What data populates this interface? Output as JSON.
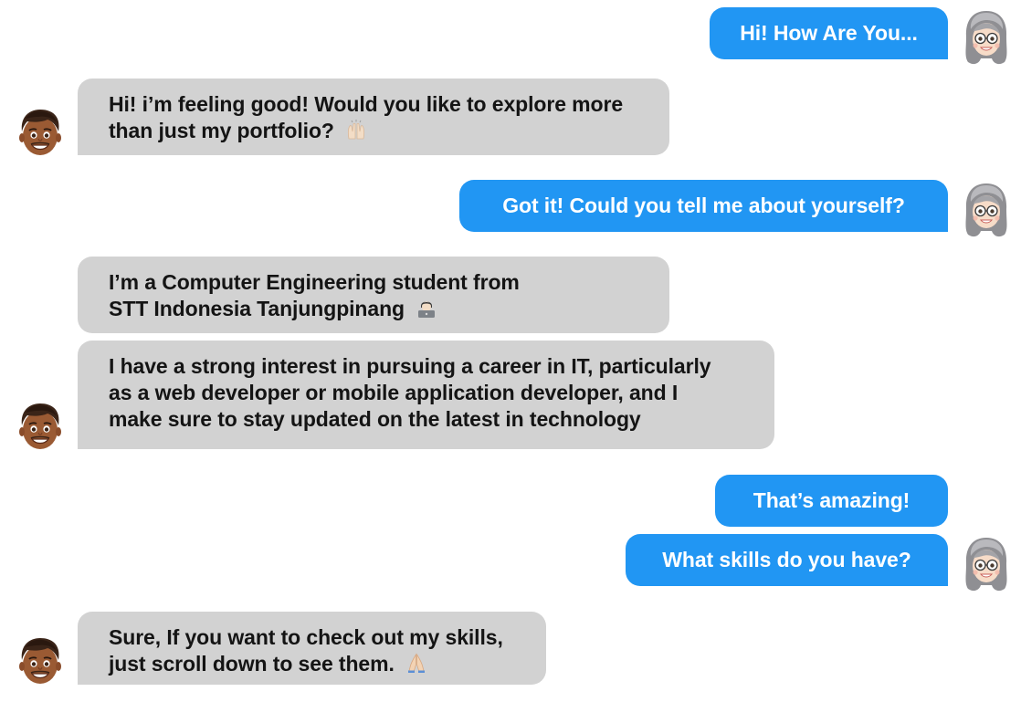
{
  "chat": {
    "messages": [
      {
        "sender": "user",
        "lines": [
          "Hi! How Are You..."
        ]
      },
      {
        "sender": "bot",
        "lines": [
          "Hi! i’m feeling good! Would you like to explore more",
          "than just my portfolio?"
        ],
        "emoji": "raising-hands-emoji"
      },
      {
        "sender": "user",
        "lines": [
          "Got it! Could you tell me about yourself?"
        ]
      },
      {
        "sender": "bot",
        "lines": [
          "I’m a Computer Engineering student from",
          "STT Indonesia Tanjungpinang"
        ],
        "emoji": "technologist-emoji"
      },
      {
        "sender": "bot",
        "lines": [
          "I have a strong interest in pursuing a career in IT, particularly",
          "as a web developer or mobile application developer, and I",
          "make sure to stay updated on the latest in technology"
        ]
      },
      {
        "sender": "user",
        "lines": [
          "That’s amazing!"
        ]
      },
      {
        "sender": "user",
        "lines": [
          "What skills do you have?"
        ]
      },
      {
        "sender": "bot",
        "lines": [
          "Sure, If you want to check out my skills,",
          "just scroll down to see them."
        ],
        "emoji": "folded-hands-emoji"
      }
    ]
  },
  "avatars": {
    "user": "memoji-grey-haired-woman-with-glasses-avatar",
    "bot": "memoji-man-brown-skin-avatar"
  },
  "colors": {
    "outgoing_bubble": "#2196f3",
    "outgoing_text": "#ffffff",
    "incoming_bubble": "#d2d2d2",
    "incoming_text": "#141414"
  }
}
